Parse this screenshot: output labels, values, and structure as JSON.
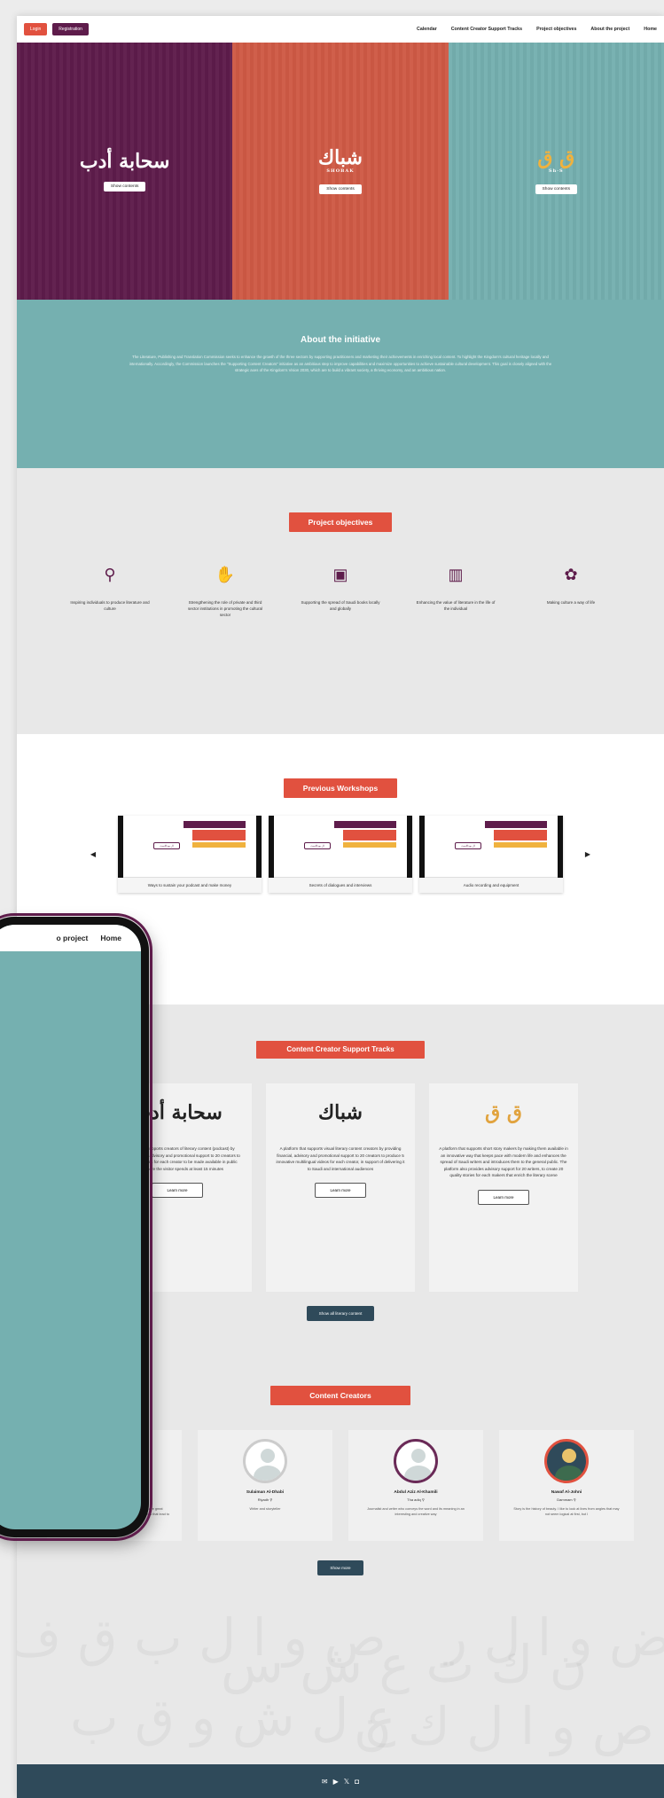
{
  "topbar": {
    "login": "Login",
    "registration": "Registration",
    "nav": [
      "Calendar",
      "Content Creator Support Tracks",
      "Project objectives",
      "About the project",
      "Home"
    ]
  },
  "hero": [
    {
      "logo": "سحابة أدب",
      "button": "Show contents"
    },
    {
      "logo": "شباك",
      "sub": "SHOBAK",
      "button": "Show contents"
    },
    {
      "logo": "ق ق",
      "sub": "Sh·S",
      "button": "Show contents"
    }
  ],
  "about": {
    "title": "About the initiative",
    "text": "The Literature, Publishing and Translation Commission seeks to enhance the growth of the three sectors by supporting practitioners and marketing their achievements in enriching local content. To highlight the Kingdom's cultural heritage locally and internationally. Accordingly, the Commission launches the \"Supporting Content Creators\" initiative as an ambitious step to improve capabilities and maximize opportunities to achieve sustainable cultural development. This goal is closely aligned with the strategic axes of the Kingdom's Vision 2030, which are to build a vibrant society, a thriving economy, and an ambitious nation."
  },
  "objectives": {
    "title": "Project objectives",
    "items": [
      {
        "icon": "lightbulb-icon",
        "glyph": "⚲",
        "text": "Inspiring individuals to produce literature and culture"
      },
      {
        "icon": "handshake-icon",
        "glyph": "✋",
        "text": "Strengthening the role of private and third sector institutions in promoting the cultural sector"
      },
      {
        "icon": "book-icon",
        "glyph": "▣",
        "text": "Supporting the spread of Saudi books locally and globally"
      },
      {
        "icon": "books-icon",
        "glyph": "▥",
        "text": "Enhancing the value of literature in the life of the individual"
      },
      {
        "icon": "culture-icon",
        "glyph": "✿",
        "text": "Making culture a way of life"
      }
    ]
  },
  "workshops": {
    "title": "Previous Workshops",
    "items": [
      "Ways to sustain your podcast and make money",
      "Secrets of dialogues and interviews",
      "Audio recording and equipment"
    ],
    "tag": "ال بودكاست"
  },
  "tracks": {
    "title": "Content Creator Support Tracks",
    "items": [
      {
        "logo": "سحابة أدب",
        "text": "A platform that supports creators of literary content (podcast) by providing financial, advisory and promotional support to 20 creators to produce 5 episodes for each creator to be made available in public places where the visitor spends at least 15 minutes",
        "button": "Learn more"
      },
      {
        "logo": "شباك",
        "sub": "SHOBAK",
        "text": "A platform that supports visual literary content creators by providing financial, advisory and promotional support to 20 creators to produce 5 innovative multilingual videos for each creator, in support of delivering it to Saudi and international audiences",
        "button": "Learn more"
      },
      {
        "logo": "ق ق",
        "sub": "Sh·S",
        "text": "A platform that supports short story makers by making them available in an innovative way that keeps pace with modern life and enhances the spread of Saudi writers and introduces them to the general public. The platform also provides advisory support for 20 writers, to create 20 quality stories for each makers that enrich the literary scene",
        "button": "Learn more"
      }
    ],
    "show_all": "Show all literary content"
  },
  "creators": {
    "title": "Content Creators",
    "items": [
      {
        "name": "Suliman Al-Sayari",
        "city": "Unaizah",
        "bio": "A university student and lover of thought and writing. I have great ambitions. Our most important of which is to publish my works that lead to no reason to fear"
      },
      {
        "name": "Sulaiman Al-Dhabi",
        "city": "Riyadh",
        "bio": "Writer and storyteller"
      },
      {
        "name": "Abdul Aziz Al-Khamili",
        "city": "Tha adiq",
        "bio": "Journalist and writer who conveys the word and its meaning in an interesting and creative way"
      },
      {
        "name": "Nawaf Al-Johni",
        "city": "Dammam",
        "bio": "Story is the history of beauty. I like to look at lives from angles that may not seem logical at first, but I"
      }
    ],
    "show_more": "Show more"
  },
  "footer": {
    "icons": [
      "mail-icon",
      "youtube-icon",
      "x-icon",
      "instagram-icon"
    ],
    "glyphs": [
      "✉",
      "▶",
      "𝕏",
      "◘"
    ]
  },
  "phone": {
    "nav": [
      "o project",
      "Home"
    ]
  },
  "colors": {
    "purple": "#5e1c4b",
    "red": "#e1513f",
    "teal": "#75b0b0",
    "navy": "#2f4a5a"
  }
}
